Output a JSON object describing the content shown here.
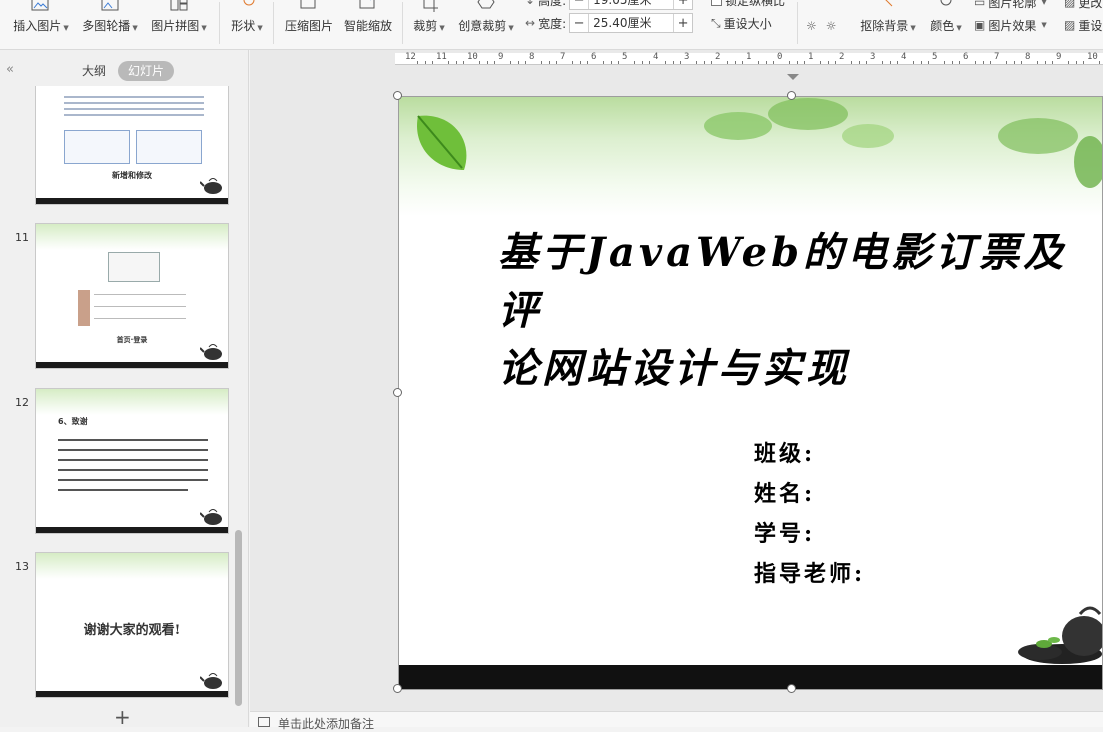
{
  "toolbar": {
    "insert_image": "插入图片",
    "multi_carousel": "多图轮播",
    "image_collage": "图片拼图",
    "shape": "形状",
    "compress_image": "压缩图片",
    "smart_zoom": "智能缩放",
    "crop": "裁剪",
    "creative_crop": "创意裁剪",
    "height_label": "高度:",
    "height_value": "19.05厘米",
    "lock_ratio": "锁定纵横比",
    "width_label": "宽度:",
    "width_value": "25.40厘米",
    "reset_size": "重设大小",
    "remove_bg": "抠除背景",
    "color": "颜色",
    "image_outline": "图片轮廓",
    "image_effects": "图片效果",
    "change": "更改",
    "reset": "重设"
  },
  "left_panel": {
    "tab_outline": "大纲",
    "tab_slides": "幻灯片",
    "thumbnails": [
      {
        "number": "",
        "caption": "新增和修改"
      },
      {
        "number": "11",
        "caption": "首页·登录"
      },
      {
        "number": "12",
        "heading": "6、致谢",
        "caption": ""
      },
      {
        "number": "13",
        "caption": "谢谢大家的观看!"
      }
    ],
    "add_symbol": "+"
  },
  "ruler": {
    "labels": [
      "12",
      "11",
      "10",
      "9",
      "8",
      "7",
      "6",
      "5",
      "4",
      "3",
      "2",
      "1",
      "0",
      "1",
      "2",
      "3",
      "4",
      "5",
      "6",
      "7",
      "8",
      "9",
      "10"
    ]
  },
  "slide": {
    "title_line1": "基于JavaWeb的电影订票及评",
    "title_line2": "论网站设计与实现",
    "class_label": "班级:",
    "name_label": "姓名:",
    "student_id_label": "学号:",
    "advisor_label": "指导老师:"
  },
  "notes": {
    "placeholder": "单击此处添加备注"
  }
}
